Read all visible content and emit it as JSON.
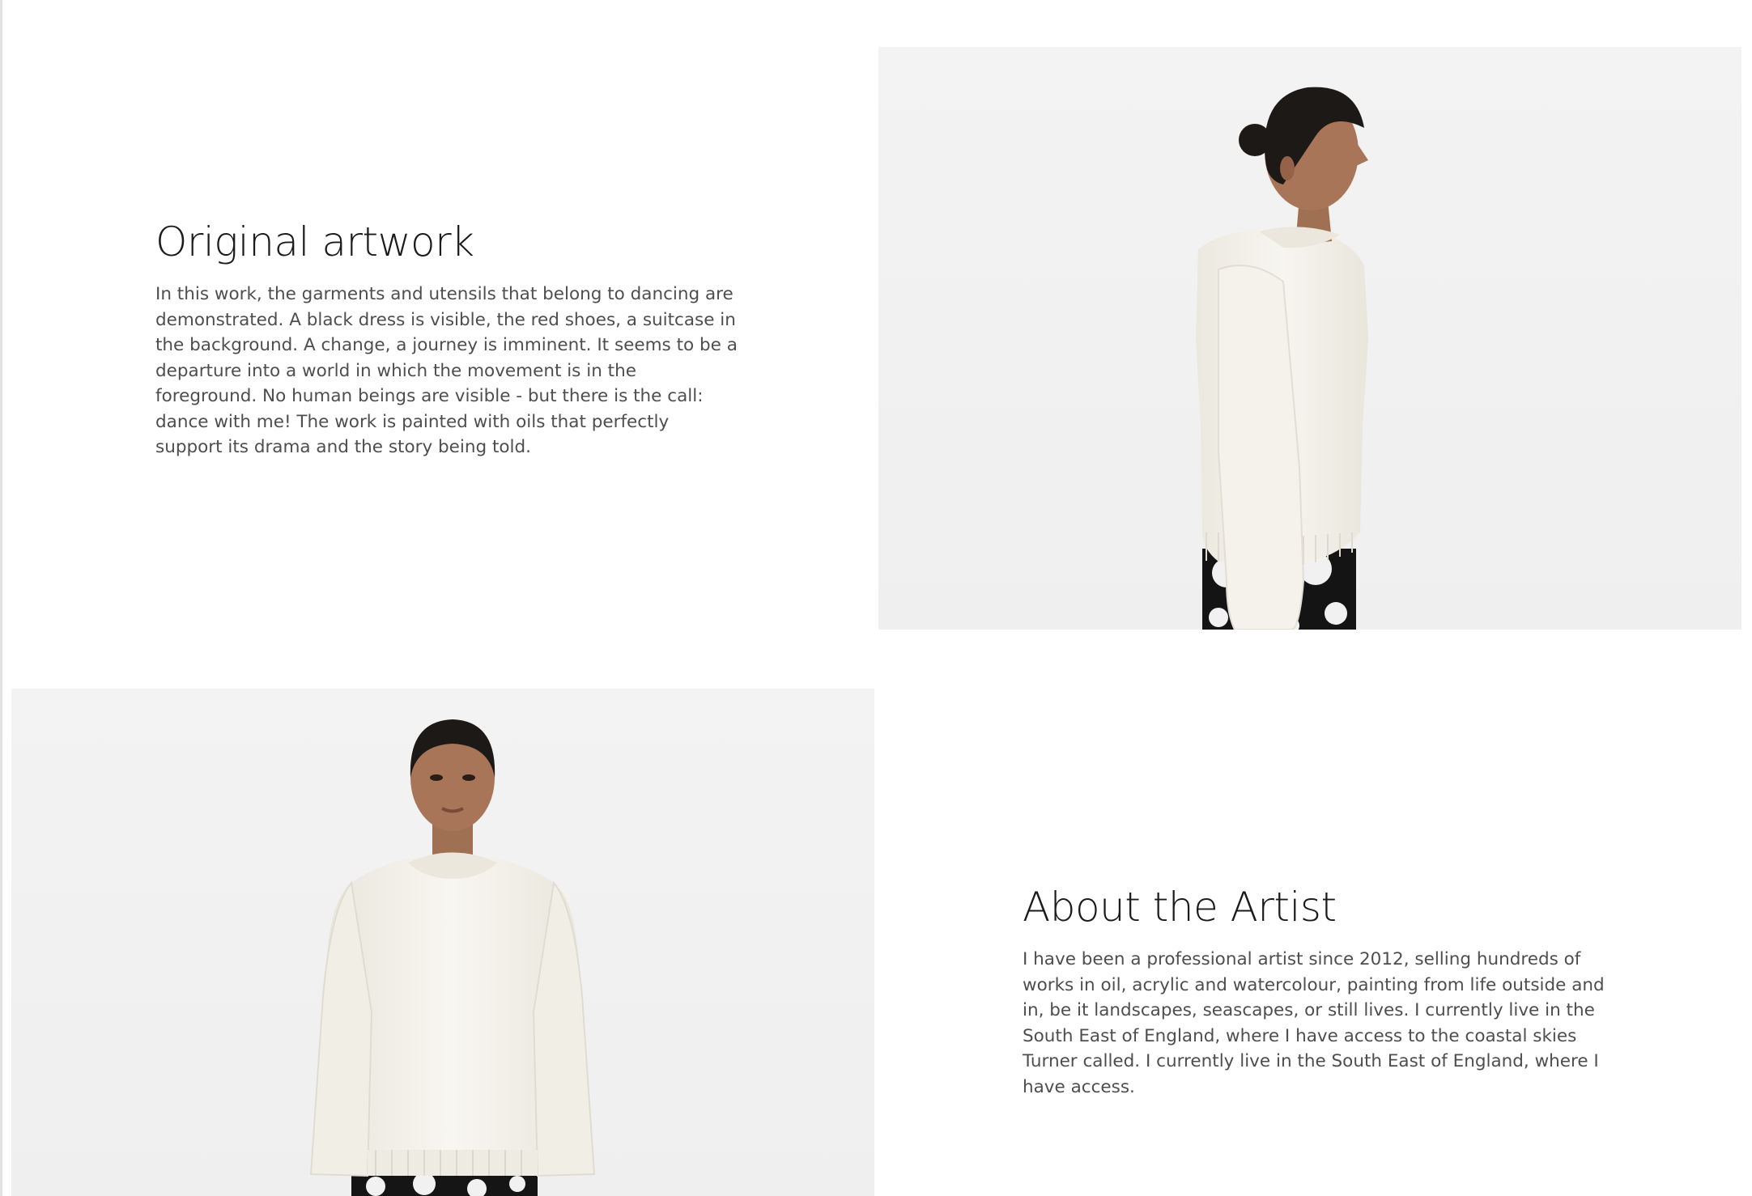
{
  "artwork": {
    "heading": "Original artwork",
    "body": "In this work, the garments and utensils that belong to dancing are demonstrated. A black dress is visible, the red shoes, a suitcase in the background. A change, a journey is imminent. It seems to be a departure into a world in which the movement is in the foreground. No human beings are visible - but there is the call: dance with me! The work is painted with oils that perfectly support its drama and the story being told."
  },
  "artist": {
    "heading": "About the Artist",
    "body": "I have been a professional artist since 2012, selling hundreds of works in oil, acrylic and watercolour, painting from life outside and in, be it landscapes, seascapes, or still lives. I currently live in the South East of England, where I have access to the coastal skies Turner called. I currently live in the South East of England, where I have access."
  },
  "colors": {
    "background": "#ffffff",
    "photo_background": "#f1f1f1",
    "heading": "#1b1b1b",
    "body_text": "#4e4e4e",
    "sweater": "#f6f4ee",
    "hair": "#1c1917",
    "skin": "#a97558"
  }
}
